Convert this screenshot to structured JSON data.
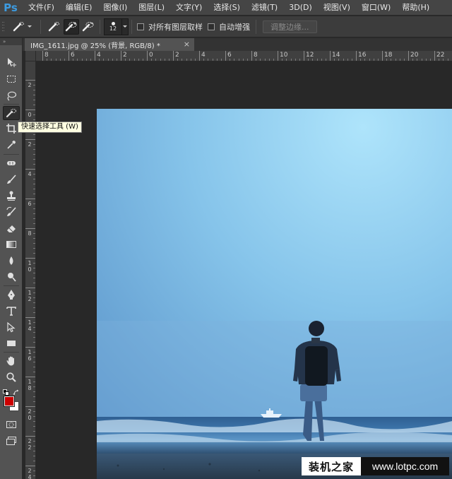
{
  "app": {
    "logo": "Ps"
  },
  "menu": [
    "文件(F)",
    "编辑(E)",
    "图像(I)",
    "图层(L)",
    "文字(Y)",
    "选择(S)",
    "滤镜(T)",
    "3D(D)",
    "视图(V)",
    "窗口(W)",
    "帮助(H)"
  ],
  "options": {
    "brush_size": "12",
    "sample_all_layers_label": "对所有图层取样",
    "sample_all_layers_checked": false,
    "auto_enhance_label": "自动增强",
    "auto_enhance_checked": false,
    "refine_edge_label": "调整边缘..."
  },
  "document": {
    "tab_title": "IMG_1611.jpg @ 25% (背景, RGB/8) *",
    "close_symbol": "×"
  },
  "tooltip": "快速选择工具 (W)",
  "rulers": {
    "horizontal_labels": [
      "8",
      "6",
      "4",
      "2",
      "0",
      "2",
      "4",
      "6",
      "8",
      "10",
      "12",
      "14",
      "16",
      "18",
      "20",
      "22"
    ],
    "vertical_labels": [
      "2",
      "0",
      "2",
      "4",
      "6",
      "8",
      "10",
      "12",
      "14",
      "16",
      "18",
      "20",
      "22",
      "24"
    ]
  },
  "tools": [
    {
      "name": "move-tool",
      "icon": "move-icon"
    },
    {
      "name": "marquee-tool",
      "icon": "rect-marquee-icon"
    },
    {
      "name": "lasso-tool",
      "icon": "lasso-icon"
    },
    {
      "name": "quick-selection-tool",
      "icon": "quick-selection-icon",
      "selected": true
    },
    {
      "name": "crop-tool",
      "icon": "crop-icon"
    },
    {
      "name": "eyedropper-tool",
      "icon": "eyedropper-icon"
    },
    {
      "name": "spot-healing-tool",
      "icon": "healing-icon"
    },
    {
      "name": "brush-tool",
      "icon": "brush-icon"
    },
    {
      "name": "clone-stamp-tool",
      "icon": "stamp-icon"
    },
    {
      "name": "history-brush-tool",
      "icon": "history-brush-icon"
    },
    {
      "name": "eraser-tool",
      "icon": "eraser-icon"
    },
    {
      "name": "gradient-tool",
      "icon": "gradient-icon"
    },
    {
      "name": "blur-tool",
      "icon": "blur-icon"
    },
    {
      "name": "dodge-tool",
      "icon": "dodge-icon"
    },
    {
      "name": "pen-tool",
      "icon": "pen-icon"
    },
    {
      "name": "type-tool",
      "icon": "type-icon"
    },
    {
      "name": "path-selection-tool",
      "icon": "path-selection-icon"
    },
    {
      "name": "shape-tool",
      "icon": "rectangle-icon"
    },
    {
      "name": "hand-tool",
      "icon": "hand-icon"
    },
    {
      "name": "zoom-tool",
      "icon": "zoom-icon"
    }
  ],
  "colors": {
    "foreground": "#cc0000",
    "background": "#ffffff"
  },
  "watermark": {
    "left_text": "装机之家",
    "right_text": "www.lotpc.com"
  }
}
